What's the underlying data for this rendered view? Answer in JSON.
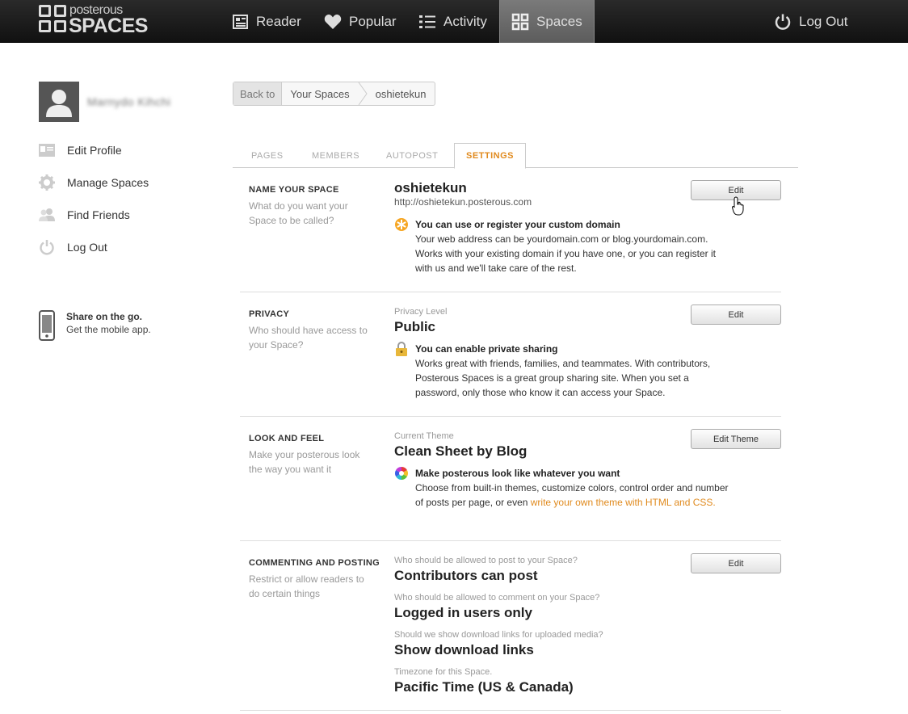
{
  "brand": {
    "top": "posterous",
    "bottom": "SPACES"
  },
  "nav": {
    "reader": "Reader",
    "popular": "Popular",
    "activity": "Activity",
    "spaces": "Spaces",
    "logout": "Log Out"
  },
  "profile": {
    "username": "Marnydo Kihchi"
  },
  "sidebar": {
    "items": [
      {
        "label": "Edit Profile",
        "icon": "id-card-icon"
      },
      {
        "label": "Manage Spaces",
        "icon": "gear-icon"
      },
      {
        "label": "Find Friends",
        "icon": "people-icon"
      },
      {
        "label": "Log Out",
        "icon": "power-icon"
      }
    ],
    "mobile_title": "Share on the go.",
    "mobile_sub": "Get the mobile app."
  },
  "breadcrumb": {
    "back": "Back to",
    "spaces": "Your Spaces",
    "current": "oshietekun"
  },
  "tabs": [
    "PAGES",
    "MEMBERS",
    "AUTOPOST",
    "SETTINGS"
  ],
  "sections": {
    "name": {
      "title": "NAME YOUR SPACE",
      "desc": "What do you want your Space to be called?",
      "value": "oshietekun",
      "url": "http://oshietekun.posterous.com",
      "button": "Edit",
      "note_title": "You can use or register your custom domain",
      "note_body": "Your web address can be yourdomain.com or blog.yourdomain.com. Works with your existing domain if you have one, or you can register it with us and we'll take care of the rest."
    },
    "privacy": {
      "title": "PRIVACY",
      "desc": "Who should have access to your Space?",
      "label": "Privacy Level",
      "value": "Public",
      "button": "Edit",
      "note_title": "You can enable private sharing",
      "note_body": "Works great with friends, families, and teammates. With contributors, Posterous Spaces is a great group sharing site. When you set a password, only those who know it can access your Space."
    },
    "look": {
      "title": "LOOK AND FEEL",
      "desc": "Make your posterous look the way you want it",
      "label": "Current Theme",
      "value": "Clean Sheet by Blog",
      "button": "Edit Theme",
      "note_title": "Make posterous look like whatever you want",
      "note_body": "Choose from built-in themes, customize colors, control order and number of posts per page, or even ",
      "note_link": "write your own theme with HTML and CSS."
    },
    "commenting": {
      "title": "COMMENTING AND POSTING",
      "desc": "Restrict or allow readers to do certain things",
      "button": "Edit",
      "post_label": "Who should be allowed to post to your Space?",
      "post_value": "Contributors can post",
      "comment_label": "Who should be allowed to comment on your Space?",
      "comment_value": "Logged in users only",
      "download_label": "Should we show download links for uploaded media?",
      "download_value": "Show download links",
      "tz_label": "Timezone for this Space.",
      "tz_value": "Pacific Time (US & Canada)"
    }
  },
  "colors": {
    "accent": "#e08a1e",
    "topbar": "#1a1a1a"
  }
}
